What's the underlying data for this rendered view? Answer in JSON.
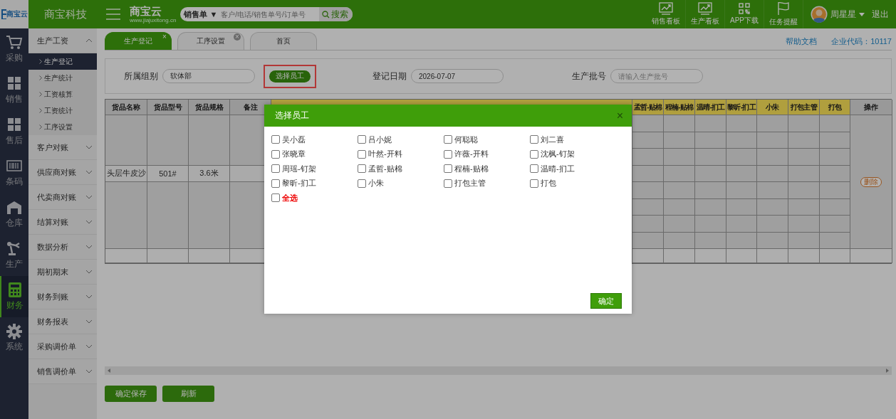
{
  "header": {
    "logo_text": "商宝云",
    "company": "商宝科技",
    "brand": "商宝云",
    "brand_url": "www.jiajuxitong.cn",
    "search": {
      "type": "销售单 ▼",
      "placeholder": "客户/电话/销售单号/订单号",
      "button": "搜索"
    },
    "tools": [
      {
        "label": "销售看板",
        "kind": "chart"
      },
      {
        "label": "生产看板",
        "kind": "chart"
      },
      {
        "label": "APP下载",
        "kind": "qr"
      },
      {
        "label": "任务提醒",
        "kind": "flag"
      }
    ],
    "user": "周星星",
    "logout": "退出"
  },
  "nav": [
    {
      "label": "采购",
      "kind": "cart",
      "selected": false
    },
    {
      "label": "销售",
      "kind": "blocks",
      "selected": false
    },
    {
      "label": "售后",
      "kind": "blocks",
      "selected": false
    },
    {
      "label": "条码",
      "kind": "barcode",
      "selected": false
    },
    {
      "label": "仓库",
      "kind": "house",
      "selected": false
    },
    {
      "label": "生产",
      "kind": "robot",
      "selected": false
    },
    {
      "label": "财务",
      "kind": "calc",
      "selected": true
    },
    {
      "label": "系统",
      "kind": "gear",
      "selected": false
    }
  ],
  "menu": [
    {
      "label": "生产工资",
      "expanded": true,
      "children": [
        {
          "label": "生产登记",
          "selected": true
        },
        {
          "label": "生产统计",
          "selected": false
        },
        {
          "label": "工资核算",
          "selected": false
        },
        {
          "label": "工资统计",
          "selected": false
        },
        {
          "label": "工序设置",
          "selected": false
        }
      ]
    },
    {
      "label": "客户对账",
      "expanded": false
    },
    {
      "label": "供应商对账",
      "expanded": false
    },
    {
      "label": "代卖商对账",
      "expanded": false
    },
    {
      "label": "结算对账",
      "expanded": false
    },
    {
      "label": "数据分析",
      "expanded": false
    },
    {
      "label": "期初期末",
      "expanded": false
    },
    {
      "label": "财务到账",
      "expanded": false
    },
    {
      "label": "财务报表",
      "expanded": false
    },
    {
      "label": "采购调价单",
      "expanded": false
    },
    {
      "label": "销售调价单",
      "expanded": false
    }
  ],
  "tabs": [
    {
      "label": "生产登记",
      "selected": true,
      "close": "×"
    },
    {
      "label": "工序设置",
      "selected": false,
      "close": "×"
    },
    {
      "label": "首页",
      "selected": false
    }
  ],
  "help_link": "帮助文档",
  "company_code": "企业代码：10117",
  "form": {
    "group_label": "所属组别",
    "group_value": "软体部",
    "pick_button": "选择员工",
    "date_label": "登记日期",
    "date_value": "2026-07-07",
    "batch_label": "生产批号",
    "batch_placeholder": "请输入生产批号"
  },
  "table": {
    "columns": [
      "货品名称",
      "货品型号",
      "货品规格",
      "备注"
    ],
    "worker_columns": [
      "孟哲-贴棉",
      "程楠-贴棉",
      "温晴-扪工",
      "黎昕-扪工",
      "小朱",
      "打包主管",
      "打包"
    ],
    "action_column": "操作",
    "rows": [
      {
        "cells": [
          "头层牛皮沙",
          "501#",
          "3.6米"
        ],
        "action": "删除"
      }
    ]
  },
  "buttons": [
    "确定保存",
    "刷新"
  ],
  "dialog": {
    "title": "选择员工",
    "close": "×",
    "options": [
      {
        "label": "吴小磊",
        "checked": false,
        "kind": "person"
      },
      {
        "label": "吕小妮",
        "checked": false,
        "kind": "person"
      },
      {
        "label": "何聪聪",
        "checked": false,
        "kind": "person"
      },
      {
        "label": "刘二喜",
        "checked": false,
        "kind": "person"
      },
      {
        "label": "张晓章",
        "checked": false,
        "kind": "person"
      },
      {
        "label": "叶然-开料",
        "checked": false,
        "kind": "person"
      },
      {
        "label": "许薇-开料",
        "checked": false,
        "kind": "person"
      },
      {
        "label": "沈枫-钉架",
        "checked": false,
        "kind": "person"
      },
      {
        "label": "周瑶-钉架",
        "checked": false,
        "kind": "person"
      },
      {
        "label": "孟哲-贴棉",
        "checked": false,
        "kind": "person"
      },
      {
        "label": "程楠-贴棉",
        "checked": false,
        "kind": "person"
      },
      {
        "label": "温晴-扪工",
        "checked": false,
        "kind": "person"
      },
      {
        "label": "黎昕-扪工",
        "checked": false,
        "kind": "person"
      },
      {
        "label": "小朱",
        "checked": false,
        "kind": "person"
      },
      {
        "label": "打包主管",
        "checked": false,
        "kind": "person"
      },
      {
        "label": "打包",
        "checked": false,
        "kind": "person"
      },
      {
        "label": "全选",
        "checked": false,
        "kind": "all"
      }
    ],
    "confirm": "确定"
  }
}
